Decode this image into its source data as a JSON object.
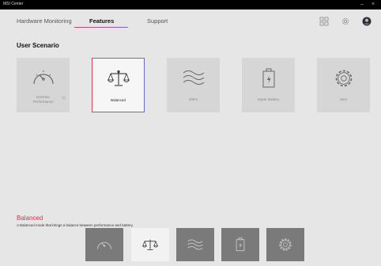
{
  "window": {
    "title": "MSI Center"
  },
  "tabs": [
    {
      "label": "Hardware Monitoring"
    },
    {
      "label": "Features"
    },
    {
      "label": "Support"
    }
  ],
  "section": {
    "title": "User Scenario"
  },
  "cards": [
    {
      "label_line1": "Extreme",
      "label_line2": "Performance",
      "icon": "speedometer-icon"
    },
    {
      "label": "Balanced",
      "icon": "balance-scale-icon",
      "selected": true
    },
    {
      "label": "Silent",
      "icon": "waves-icon"
    },
    {
      "label": "Super Battery",
      "icon": "battery-bolt-icon"
    },
    {
      "label": "User",
      "icon": "gear-icon"
    }
  ],
  "description": {
    "title": "Balanced",
    "text": "A Balanced mode that brings a balance between performance and battery."
  },
  "colors": {
    "accent_red": "#e2303f",
    "accent_purple": "#6a6ac8",
    "background": "#e6e6e6",
    "card": "#d6d6d6"
  }
}
